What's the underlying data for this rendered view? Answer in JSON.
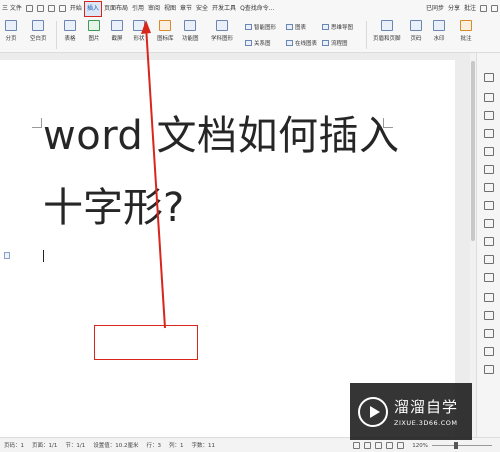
{
  "menu": {
    "file": "三 文件",
    "items": [
      "开始",
      "插入",
      "页面布局",
      "引用",
      "审阅",
      "视图",
      "章节",
      "安全",
      "开发工具"
    ],
    "active_item": "插入",
    "search": "Q查找命令...",
    "sync": "已同步",
    "share": "分享",
    "comment": "批注"
  },
  "ribbon": {
    "big_buttons": [
      "分页",
      "空白页",
      "表格",
      "图片",
      "截屏",
      "形状",
      "图标库",
      "功能图",
      "学科图形",
      "页眉和页脚",
      "页码",
      "水印",
      "批注"
    ],
    "small_buttons": [
      "智能图形",
      "图表",
      "思维导图",
      "关系图",
      "在线图表",
      "流程图"
    ]
  },
  "document": {
    "line1": "word 文档如何插入",
    "line2": "十字形?"
  },
  "statusbar": {
    "page_num": "页码：1",
    "pages": "页面：1/1",
    "section": "节：1/1",
    "setting": "设置值：10.2厘米",
    "row": "行：3",
    "col": "列：1",
    "words": "字数：11",
    "zoom": "120%"
  },
  "watermark": {
    "brand": "溜溜自学",
    "url": "ZIXUE.3D66.COM"
  },
  "colors": {
    "annotation_red": "#d9261c",
    "active_tab": "#1a5fb4"
  }
}
